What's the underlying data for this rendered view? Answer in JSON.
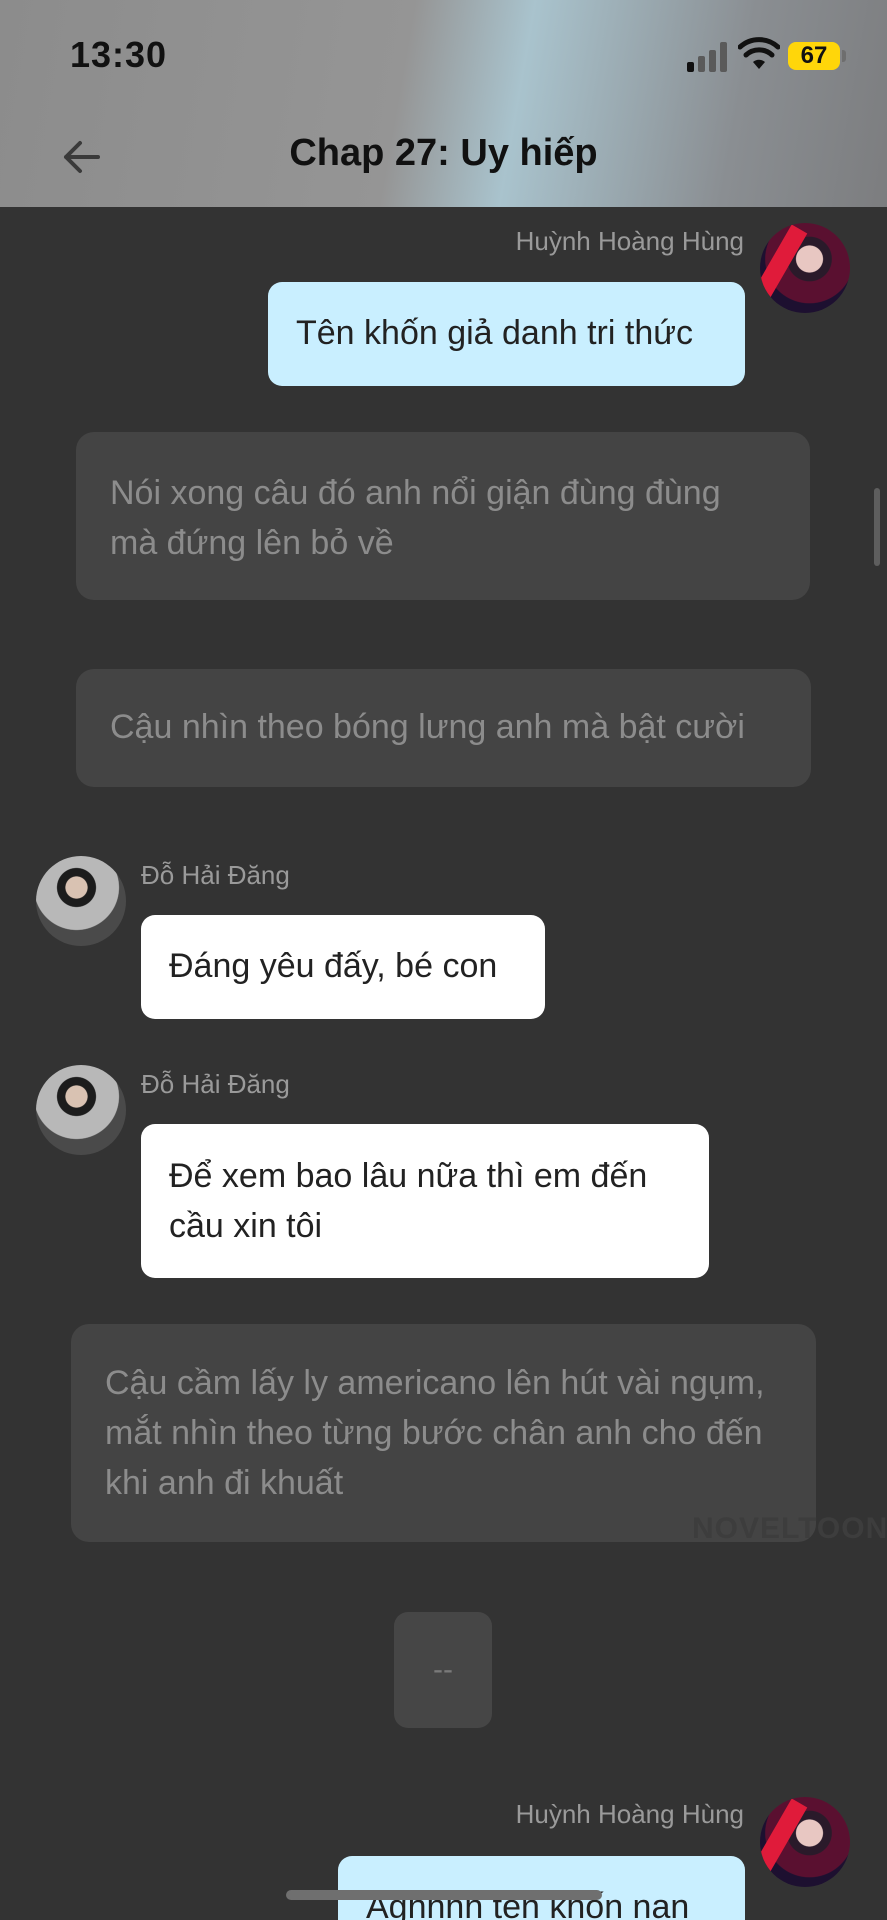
{
  "status_bar": {
    "time": "13:30",
    "battery": "67",
    "signal_icon": "signal-bars-icon",
    "wifi_icon": "wifi-icon"
  },
  "header": {
    "title": "Chap 27: Uy hiếp",
    "back_icon": "arrow-left-icon"
  },
  "messages": [
    {
      "type": "self",
      "sender": "Huỳnh Hoàng Hùng",
      "text": "Tên khốn giả danh tri thức"
    },
    {
      "type": "narration",
      "text": "Nói xong câu đó anh nổi giận đùng đùng mà đứng lên bỏ về"
    },
    {
      "type": "narration",
      "text": "Cậu nhìn theo bóng lưng anh mà bật cười"
    },
    {
      "type": "other",
      "sender": "Đỗ Hải Đăng",
      "text": "Đáng yêu đấy, bé con"
    },
    {
      "type": "other",
      "sender": "Đỗ Hải Đăng",
      "text": "Để xem bao lâu nữa thì em đến cầu xin tôi"
    },
    {
      "type": "narration",
      "text": "Cậu cầm lấy ly americano lên hút vài ngụm, mắt nhìn theo từng bước chân anh cho đến khi anh đi khuất"
    },
    {
      "type": "separator",
      "text": "--"
    },
    {
      "type": "self",
      "sender": "Huỳnh Hoàng Hùng",
      "text": "Aghhhh tên khốn nạn"
    }
  ],
  "watermark": "NOVELTOON",
  "colors": {
    "background": "#333333",
    "self_bubble": "#c9efff",
    "other_bubble": "#ffffff",
    "narration_bubble": "#444444",
    "battery": "#ffd60a"
  }
}
